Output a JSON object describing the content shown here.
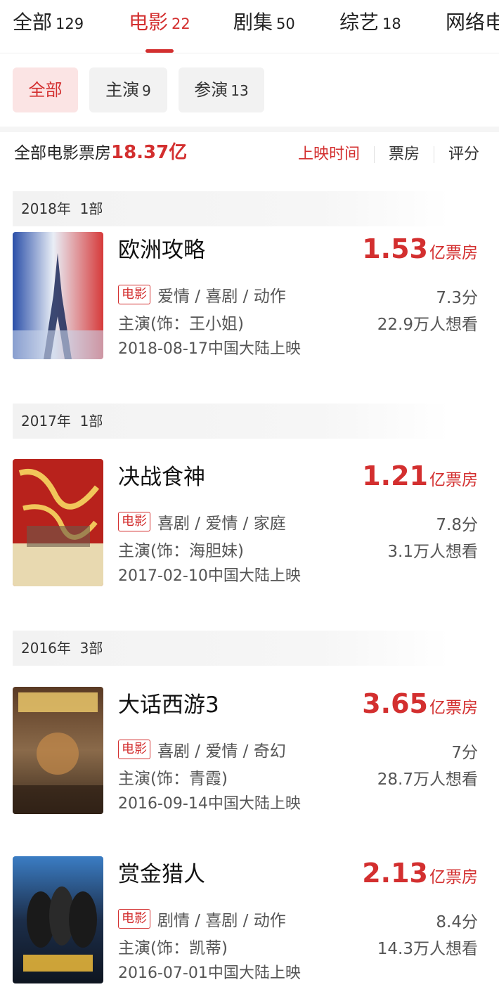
{
  "tabs": [
    {
      "label": "全部",
      "count": "129"
    },
    {
      "label": "电影",
      "count": "22"
    },
    {
      "label": "剧集",
      "count": "50"
    },
    {
      "label": "综艺",
      "count": "18"
    },
    {
      "label": "网络电",
      "count": ""
    }
  ],
  "active_tab": "电影",
  "filters": [
    {
      "label": "全部",
      "count": ""
    },
    {
      "label": "主演",
      "count": "9"
    },
    {
      "label": "参演",
      "count": "13"
    }
  ],
  "summary": {
    "label": "全部电影票房",
    "amount": "18.37亿"
  },
  "sort": [
    {
      "label": "上映时间"
    },
    {
      "label": "票房"
    },
    {
      "label": "评分"
    }
  ],
  "years": [
    {
      "label": "2018年",
      "count": "1部"
    },
    {
      "label": "2017年",
      "count": "1部"
    },
    {
      "label": "2016年",
      "count": "3部"
    }
  ],
  "movies": [
    {
      "title": "欧洲攻略",
      "box_num": "1.53",
      "box_unit": "亿票房",
      "tag": "电影",
      "genres": "爱情 / 喜剧 / 动作",
      "rating": "7.3分",
      "role": "主演(饰：王小姐)",
      "want": "22.9万人想看",
      "release": "2018-08-17中国大陆上映"
    },
    {
      "title": "决战食神",
      "box_num": "1.21",
      "box_unit": "亿票房",
      "tag": "电影",
      "genres": "喜剧 / 爱情 / 家庭",
      "rating": "7.8分",
      "role": "主演(饰：海胆妹)",
      "want": "3.1万人想看",
      "release": "2017-02-10中国大陆上映"
    },
    {
      "title": "大话西游3",
      "box_num": "3.65",
      "box_unit": "亿票房",
      "tag": "电影",
      "genres": "喜剧 / 爱情 / 奇幻",
      "rating": "7分",
      "role": "主演(饰：青霞)",
      "want": "28.7万人想看",
      "release": "2016-09-14中国大陆上映"
    },
    {
      "title": "赏金猎人",
      "box_num": "2.13",
      "box_unit": "亿票房",
      "tag": "电影",
      "genres": "剧情 / 喜剧 / 动作",
      "rating": "8.4分",
      "role": "主演(饰：凯蒂)",
      "want": "14.3万人想看",
      "release": "2016-07-01中国大陆上映"
    }
  ],
  "colors": {
    "accent": "#d32f2f",
    "chip_active_bg": "#fbe4e4",
    "chip_bg": "#f2f2f2"
  }
}
